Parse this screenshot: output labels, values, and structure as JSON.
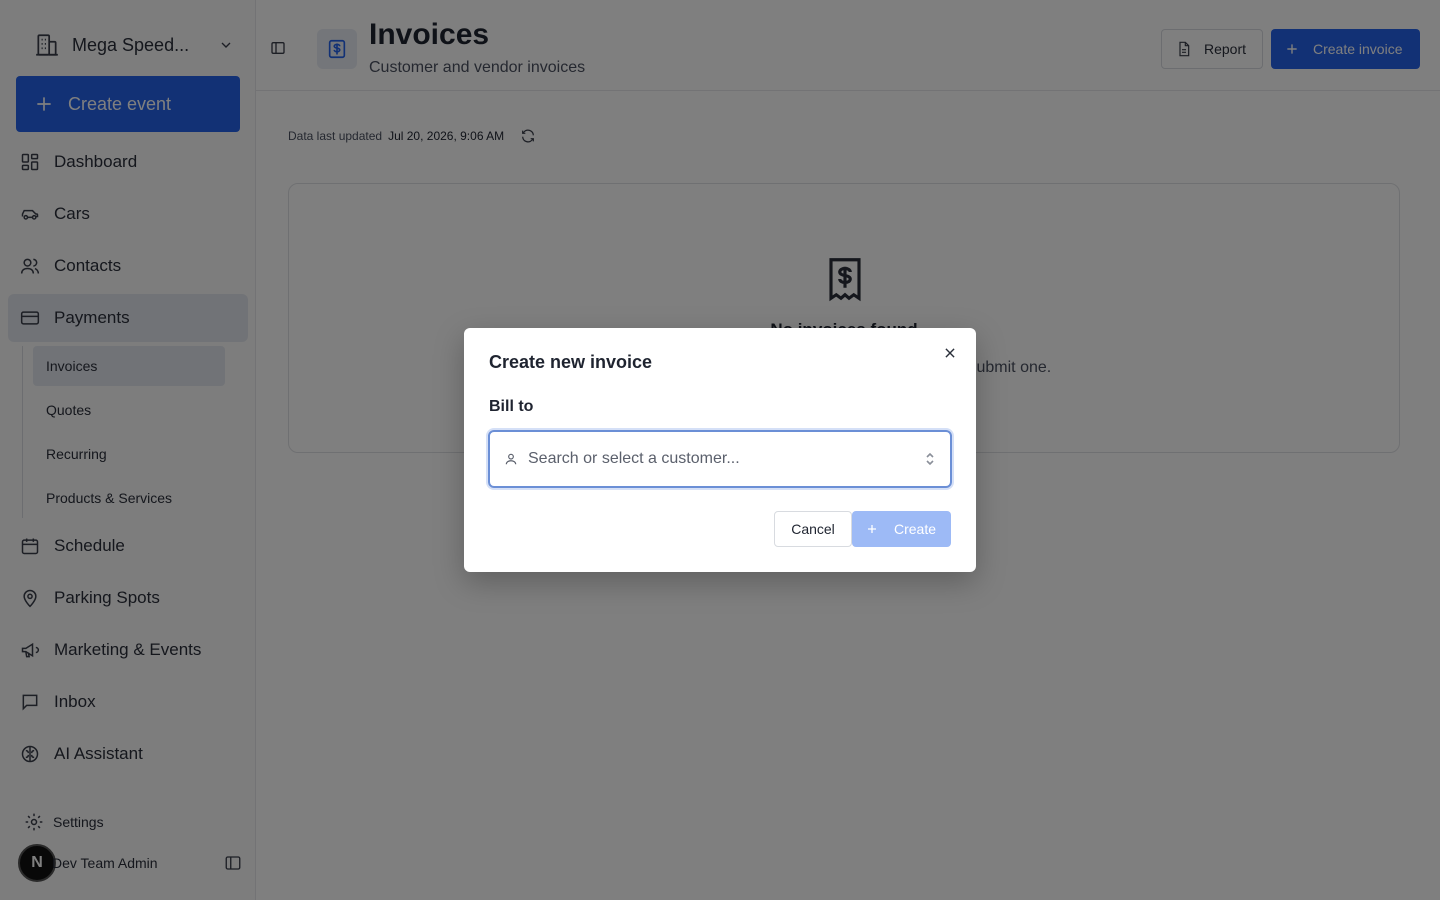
{
  "sidebar": {
    "org_name": "Mega Speed...",
    "create_event_label": "Create event",
    "nav": [
      {
        "label": "Dashboard",
        "icon": "dashboard-icon"
      },
      {
        "label": "Cars",
        "icon": "car-icon"
      },
      {
        "label": "Contacts",
        "icon": "contacts-icon"
      },
      {
        "label": "Payments",
        "icon": "credit-card-icon",
        "active": true
      }
    ],
    "payments_sub": [
      {
        "label": "Invoices",
        "active": true
      },
      {
        "label": "Quotes"
      },
      {
        "label": "Recurring"
      },
      {
        "label": "Products & Services"
      }
    ],
    "nav_after": [
      {
        "label": "Schedule",
        "icon": "calendar-icon"
      },
      {
        "label": "Parking Spots",
        "icon": "map-pin-icon"
      },
      {
        "label": "Marketing & Events",
        "icon": "megaphone-icon"
      },
      {
        "label": "Inbox",
        "icon": "message-icon"
      },
      {
        "label": "AI Assistant",
        "icon": "brain-icon"
      }
    ],
    "settings_label": "Settings",
    "user_initial": "N",
    "user_name": "Dev Team Admin"
  },
  "header": {
    "title": "Invoices",
    "subtitle": "Customer and vendor invoices",
    "report_label": "Report",
    "create_invoice_label": "Create invoice"
  },
  "status": {
    "prefix": "Data last updated",
    "timestamp": "Jul 20, 2026, 9:06 AM"
  },
  "empty_state": {
    "title": "No invoices found",
    "text": "Create your first invoice or wait for a vendor to submit one."
  },
  "modal": {
    "title": "Create new invoice",
    "bill_to_label": "Bill to",
    "customer_placeholder": "Search or select a customer...",
    "cancel_label": "Cancel",
    "create_label": "Create"
  },
  "colors": {
    "accent": "#2563eb",
    "accent_disabled": "#9dbaf6",
    "overlay": "rgba(0,0,0,0.5)"
  }
}
